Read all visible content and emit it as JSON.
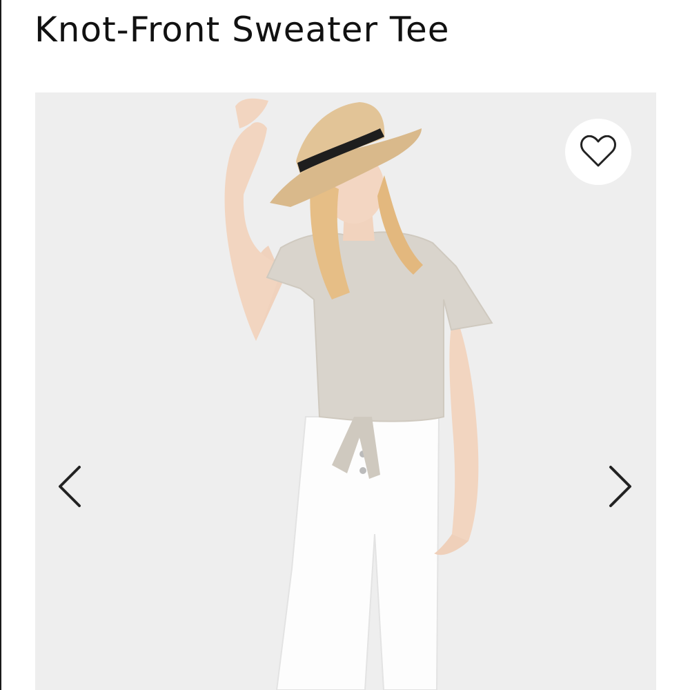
{
  "product": {
    "title": "Knot-Front Sweater Tee"
  },
  "gallery": {
    "image_alt": "Model wearing a heather knot-front sweater tee, white jeans and a straw hat",
    "favorite_icon": "heart-outline-icon",
    "prev_icon": "chevron-left-icon",
    "next_icon": "chevron-right-icon"
  },
  "colors": {
    "background": "#ffffff",
    "title_text": "#111111",
    "photo_backdrop": "#eeeeee",
    "icon_stroke": "#222222"
  }
}
